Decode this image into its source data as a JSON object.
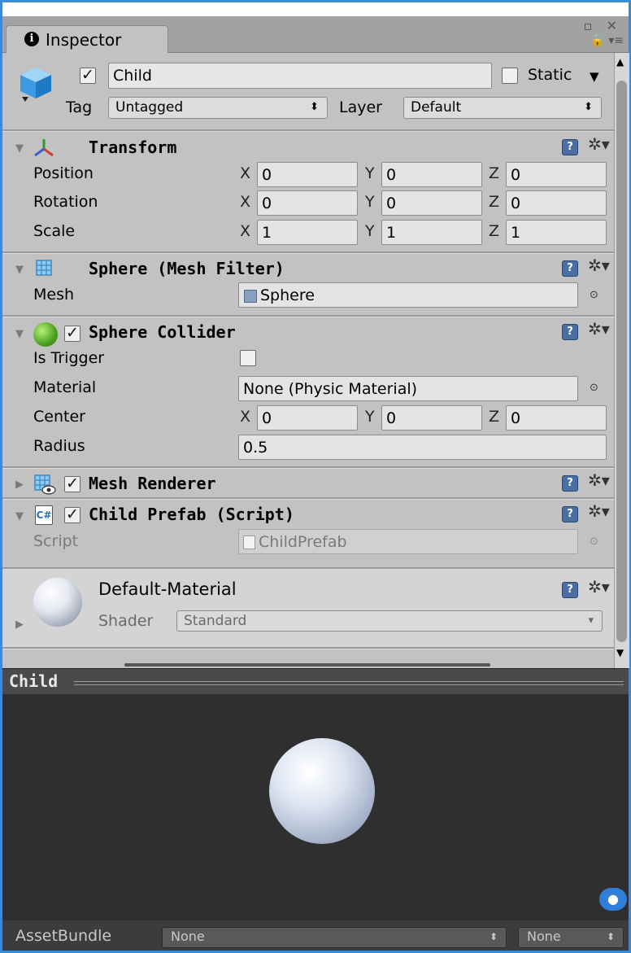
{
  "window": {
    "tab_label": "Inspector",
    "controls": "▫ ✕",
    "lock_menu": "🔒 ▾≡"
  },
  "object": {
    "name": "Child",
    "active": true,
    "static_label": "Static",
    "static_checked": false,
    "tag_label": "Tag",
    "tag_value": "Untagged",
    "layer_label": "Layer",
    "layer_value": "Default"
  },
  "transform": {
    "title": "Transform",
    "rows": [
      {
        "label": "Position",
        "x": "0",
        "y": "0",
        "z": "0"
      },
      {
        "label": "Rotation",
        "x": "0",
        "y": "0",
        "z": "0"
      },
      {
        "label": "Scale",
        "x": "1",
        "y": "1",
        "z": "1"
      }
    ]
  },
  "axis_labels": {
    "x": "X",
    "y": "Y",
    "z": "Z"
  },
  "mesh_filter": {
    "title": "Sphere (Mesh Filter)",
    "mesh_label": "Mesh",
    "mesh_value": "Sphere"
  },
  "sphere_collider": {
    "title": "Sphere Collider",
    "enabled": true,
    "is_trigger_label": "Is Trigger",
    "is_trigger": false,
    "material_label": "Material",
    "material_value": "None (Physic Material)",
    "center_label": "Center",
    "center": {
      "x": "0",
      "y": "0",
      "z": "0"
    },
    "radius_label": "Radius",
    "radius_value": "0.5"
  },
  "mesh_renderer": {
    "title": "Mesh Renderer",
    "enabled": true
  },
  "child_prefab": {
    "title": "Child Prefab (Script)",
    "enabled": true,
    "script_label": "Script",
    "script_value": "ChildPrefab"
  },
  "material": {
    "name": "Default-Material",
    "shader_label": "Shader",
    "shader_value": "Standard"
  },
  "preview": {
    "title": "Child"
  },
  "asset_bundle": {
    "label": "AssetBundle",
    "name_value": "None",
    "variant_value": "None"
  },
  "glyphs": {
    "fold_open": "▼",
    "fold_closed": "▶",
    "check": "✓",
    "gear": "✲▾",
    "help": "?",
    "target": "⊙",
    "dropdown": "⬍",
    "dropdown_small": "▾",
    "scroll_up": "▲",
    "scroll_down": "▼"
  }
}
